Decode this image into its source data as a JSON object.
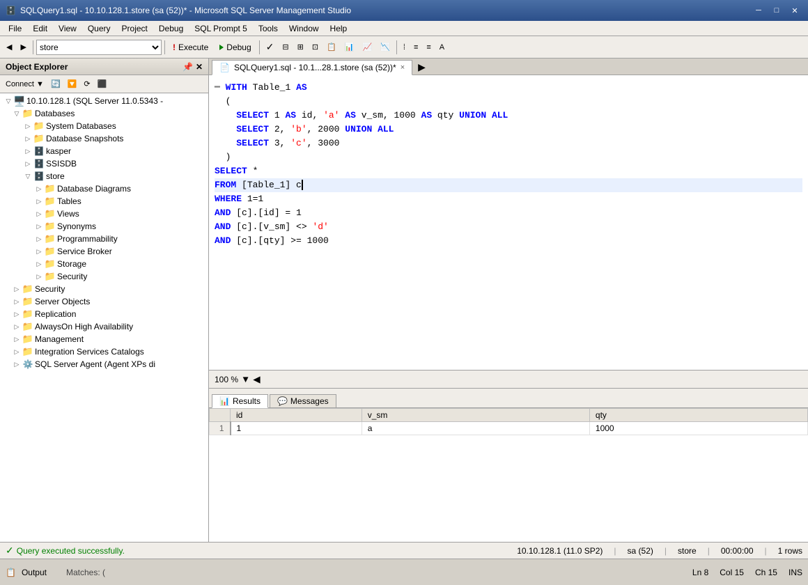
{
  "titlebar": {
    "title": "SQLQuery1.sql - 10.10.128.1.store (sa (52))* - Microsoft SQL Server Management Studio",
    "icon": "🗄️",
    "controls": [
      "minimize",
      "maximize",
      "close"
    ]
  },
  "menubar": {
    "items": [
      "File",
      "Edit",
      "View",
      "Query",
      "Project",
      "Debug",
      "SQL Prompt 5",
      "Tools",
      "Window",
      "Help"
    ]
  },
  "toolbar": {
    "db_selector_value": "store",
    "execute_label": "Execute",
    "debug_label": "Debug"
  },
  "object_explorer": {
    "title": "Object Explorer",
    "connect_label": "Connect",
    "server": "10.10.128.1 (SQL Server 11.0.5343 -",
    "nodes": [
      {
        "label": "Databases",
        "level": 1,
        "expanded": true,
        "type": "folder"
      },
      {
        "label": "System Databases",
        "level": 2,
        "type": "folder"
      },
      {
        "label": "Database Snapshots",
        "level": 2,
        "type": "folder"
      },
      {
        "label": "kasper",
        "level": 2,
        "type": "database"
      },
      {
        "label": "SSISDB",
        "level": 2,
        "type": "database"
      },
      {
        "label": "store",
        "level": 2,
        "expanded": true,
        "type": "database"
      },
      {
        "label": "Database Diagrams",
        "level": 3,
        "type": "folder"
      },
      {
        "label": "Tables",
        "level": 3,
        "type": "folder"
      },
      {
        "label": "Views",
        "level": 3,
        "type": "folder"
      },
      {
        "label": "Synonyms",
        "level": 3,
        "type": "folder"
      },
      {
        "label": "Programmability",
        "level": 3,
        "type": "folder"
      },
      {
        "label": "Service Broker",
        "level": 3,
        "type": "folder"
      },
      {
        "label": "Storage",
        "level": 3,
        "type": "folder"
      },
      {
        "label": "Security",
        "level": 3,
        "type": "folder"
      },
      {
        "label": "Security",
        "level": 1,
        "type": "folder"
      },
      {
        "label": "Server Objects",
        "level": 1,
        "type": "folder"
      },
      {
        "label": "Replication",
        "level": 1,
        "type": "folder"
      },
      {
        "label": "AlwaysOn High Availability",
        "level": 1,
        "type": "folder"
      },
      {
        "label": "Management",
        "level": 1,
        "type": "folder"
      },
      {
        "label": "Integration Services Catalogs",
        "level": 1,
        "type": "folder"
      },
      {
        "label": "SQL Server Agent (Agent XPs di",
        "level": 1,
        "type": "agent"
      }
    ]
  },
  "tab": {
    "label": "SQLQuery1.sql - 10.1...28.1.store (sa (52))*",
    "close": "×"
  },
  "sql_code": [
    {
      "line": "",
      "content": "WITH Table_1 AS"
    },
    {
      "line": "",
      "content": "("
    },
    {
      "line": "",
      "content": "    SELECT 1 AS id, 'a' AS v_sm, 1000 AS qty UNION ALL"
    },
    {
      "line": "",
      "content": "    SELECT 2, 'b', 2000 UNION ALL"
    },
    {
      "line": "",
      "content": "    SELECT 3, 'c', 3000"
    },
    {
      "line": "",
      "content": ")"
    },
    {
      "line": "",
      "content": "SELECT *"
    },
    {
      "line": "",
      "content": "FROM [Table_1] c"
    },
    {
      "line": "",
      "content": "WHERE 1=1"
    },
    {
      "line": "",
      "content": "AND [c].[id] = 1"
    },
    {
      "line": "",
      "content": "AND [c].[v_sm] <> 'd'"
    },
    {
      "line": "",
      "content": "AND [c].[qty] >= 1000"
    }
  ],
  "zoom": {
    "value": "100 %"
  },
  "results": {
    "tabs": [
      "Results",
      "Messages"
    ],
    "active_tab": "Results",
    "columns": [
      "id",
      "v_sm",
      "qty"
    ],
    "rows": [
      {
        "row_num": "1",
        "id": "1",
        "v_sm": "a",
        "qty": "1000"
      }
    ]
  },
  "statusbar": {
    "message": "Query executed successfully.",
    "server": "10.10.128.1 (11.0 SP2)",
    "user": "sa (52)",
    "db": "store",
    "time": "00:00:00",
    "rows": "1 rows"
  },
  "bottom_panel": {
    "tab_label": "Output",
    "matches_label": "Matches: ("
  },
  "editor_position": {
    "ln": "Ln 8",
    "col": "Col 15",
    "ch": "Ch 15",
    "mode": "INS"
  }
}
